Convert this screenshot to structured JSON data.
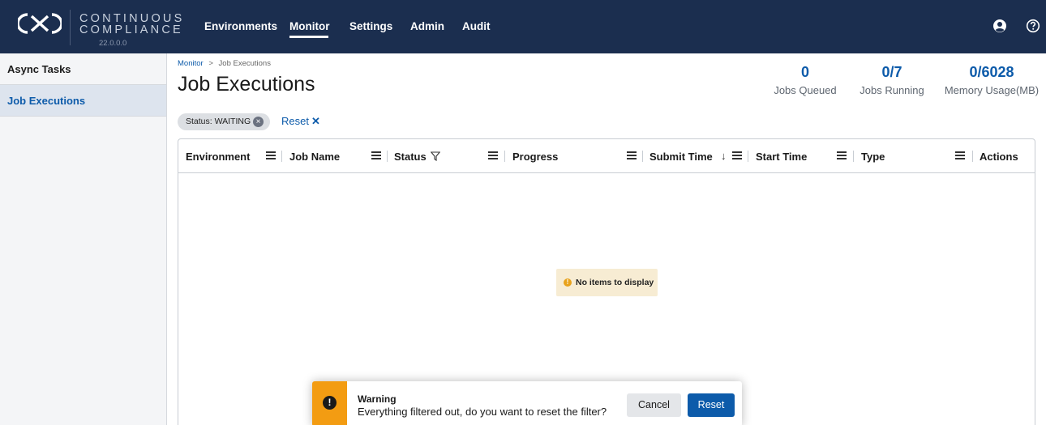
{
  "brand": {
    "line1": "CONTINUOUS",
    "line2": "COMPLIANCE",
    "version": "22.0.0.0",
    "logo_icon": "cx-logo-icon"
  },
  "nav": {
    "items": [
      {
        "label": "Environments"
      },
      {
        "label": "Monitor",
        "active": true
      },
      {
        "label": "Settings"
      },
      {
        "label": "Admin"
      },
      {
        "label": "Audit"
      }
    ],
    "icons": [
      "user-icon",
      "help-icon"
    ]
  },
  "sidebar": {
    "items": [
      {
        "label": "Async Tasks"
      },
      {
        "label": "Job Executions",
        "selected": true
      }
    ]
  },
  "breadcrumb": {
    "parent": "Monitor",
    "separator": ">",
    "current": "Job Executions"
  },
  "page": {
    "title": "Job Executions"
  },
  "stats": [
    {
      "value": "0",
      "label": "Jobs Queued"
    },
    {
      "value": "0/7",
      "label": "Jobs Running"
    },
    {
      "value": "0/6028",
      "label": "Memory Usage(MB)"
    }
  ],
  "filter": {
    "chip_label": "Status: WAITING",
    "reset_label": "Reset",
    "reset_icon": "close-icon"
  },
  "table": {
    "columns": [
      {
        "label": "Environment"
      },
      {
        "label": "Job Name"
      },
      {
        "label": "Status",
        "icon": "filter-icon"
      },
      {
        "label": "Progress"
      },
      {
        "label": "Submit Time",
        "icon": "sort-desc-icon"
      },
      {
        "label": "Start Time"
      },
      {
        "label": "Type"
      },
      {
        "label": "Actions"
      }
    ],
    "empty_text": "No items to display"
  },
  "toast": {
    "title": "Warning",
    "message": "Everything filtered out, do you want to reset the filter?",
    "cancel_label": "Cancel",
    "reset_label": "Reset",
    "icon": "warning-icon"
  },
  "colors": {
    "header_bg": "#1b2e4f",
    "accent": "#0d5baa",
    "warning": "#f39c12",
    "empty_bg": "#f7ecd3"
  }
}
